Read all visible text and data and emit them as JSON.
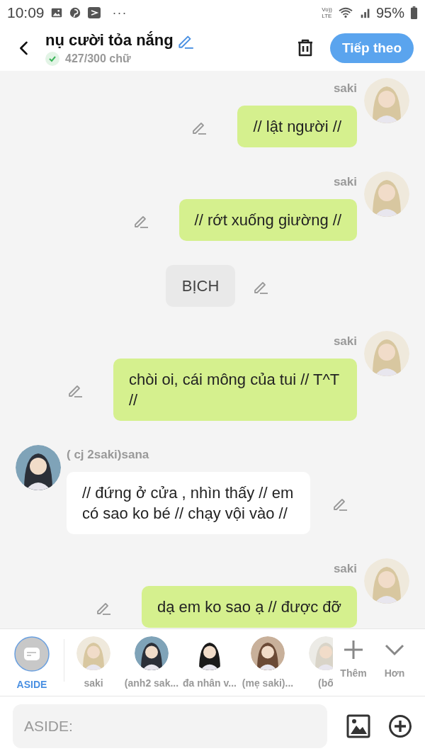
{
  "status_bar": {
    "time": "10:09",
    "more": "···",
    "network_top": "Vo))",
    "network_bottom": "LTE",
    "battery": "95%"
  },
  "header": {
    "title": "nụ cười tỏa nắng",
    "word_count": "427/300 chữ",
    "count_ok": true,
    "next_button": "Tiếp theo"
  },
  "messages": [
    {
      "kind": "outgoing",
      "sender": "saki",
      "text": "// lật người //"
    },
    {
      "kind": "outgoing",
      "sender": "saki",
      "text": "// rớt xuống giường //"
    },
    {
      "kind": "narration",
      "text": "BỊCH"
    },
    {
      "kind": "outgoing",
      "sender": "saki",
      "text": "chòi oi, cái mông của tui // T^T //"
    },
    {
      "kind": "incoming",
      "sender": "( cj 2saki)sana",
      "text": "// đứng ở cửa , nhìn thấy // em có sao ko bé // chạy vội vào //"
    },
    {
      "kind": "outgoing",
      "sender": "saki",
      "text": "dạ em ko sao ạ // được đỡ"
    }
  ],
  "characters": [
    {
      "kind": "aside",
      "label": "ASIDE",
      "selected": true
    },
    {
      "kind": "character",
      "label": "saki",
      "selected": false
    },
    {
      "kind": "character",
      "label": "(anh2 sak...",
      "selected": false
    },
    {
      "kind": "character",
      "label": "đa nhân v...",
      "selected": false
    },
    {
      "kind": "character",
      "label": "(mẹ saki)...",
      "selected": false
    },
    {
      "kind": "character",
      "label": "(bố",
      "selected": false
    }
  ],
  "add_label": "Thêm",
  "more_label": "Hơn",
  "composer": {
    "placeholder": "ASIDE:"
  }
}
